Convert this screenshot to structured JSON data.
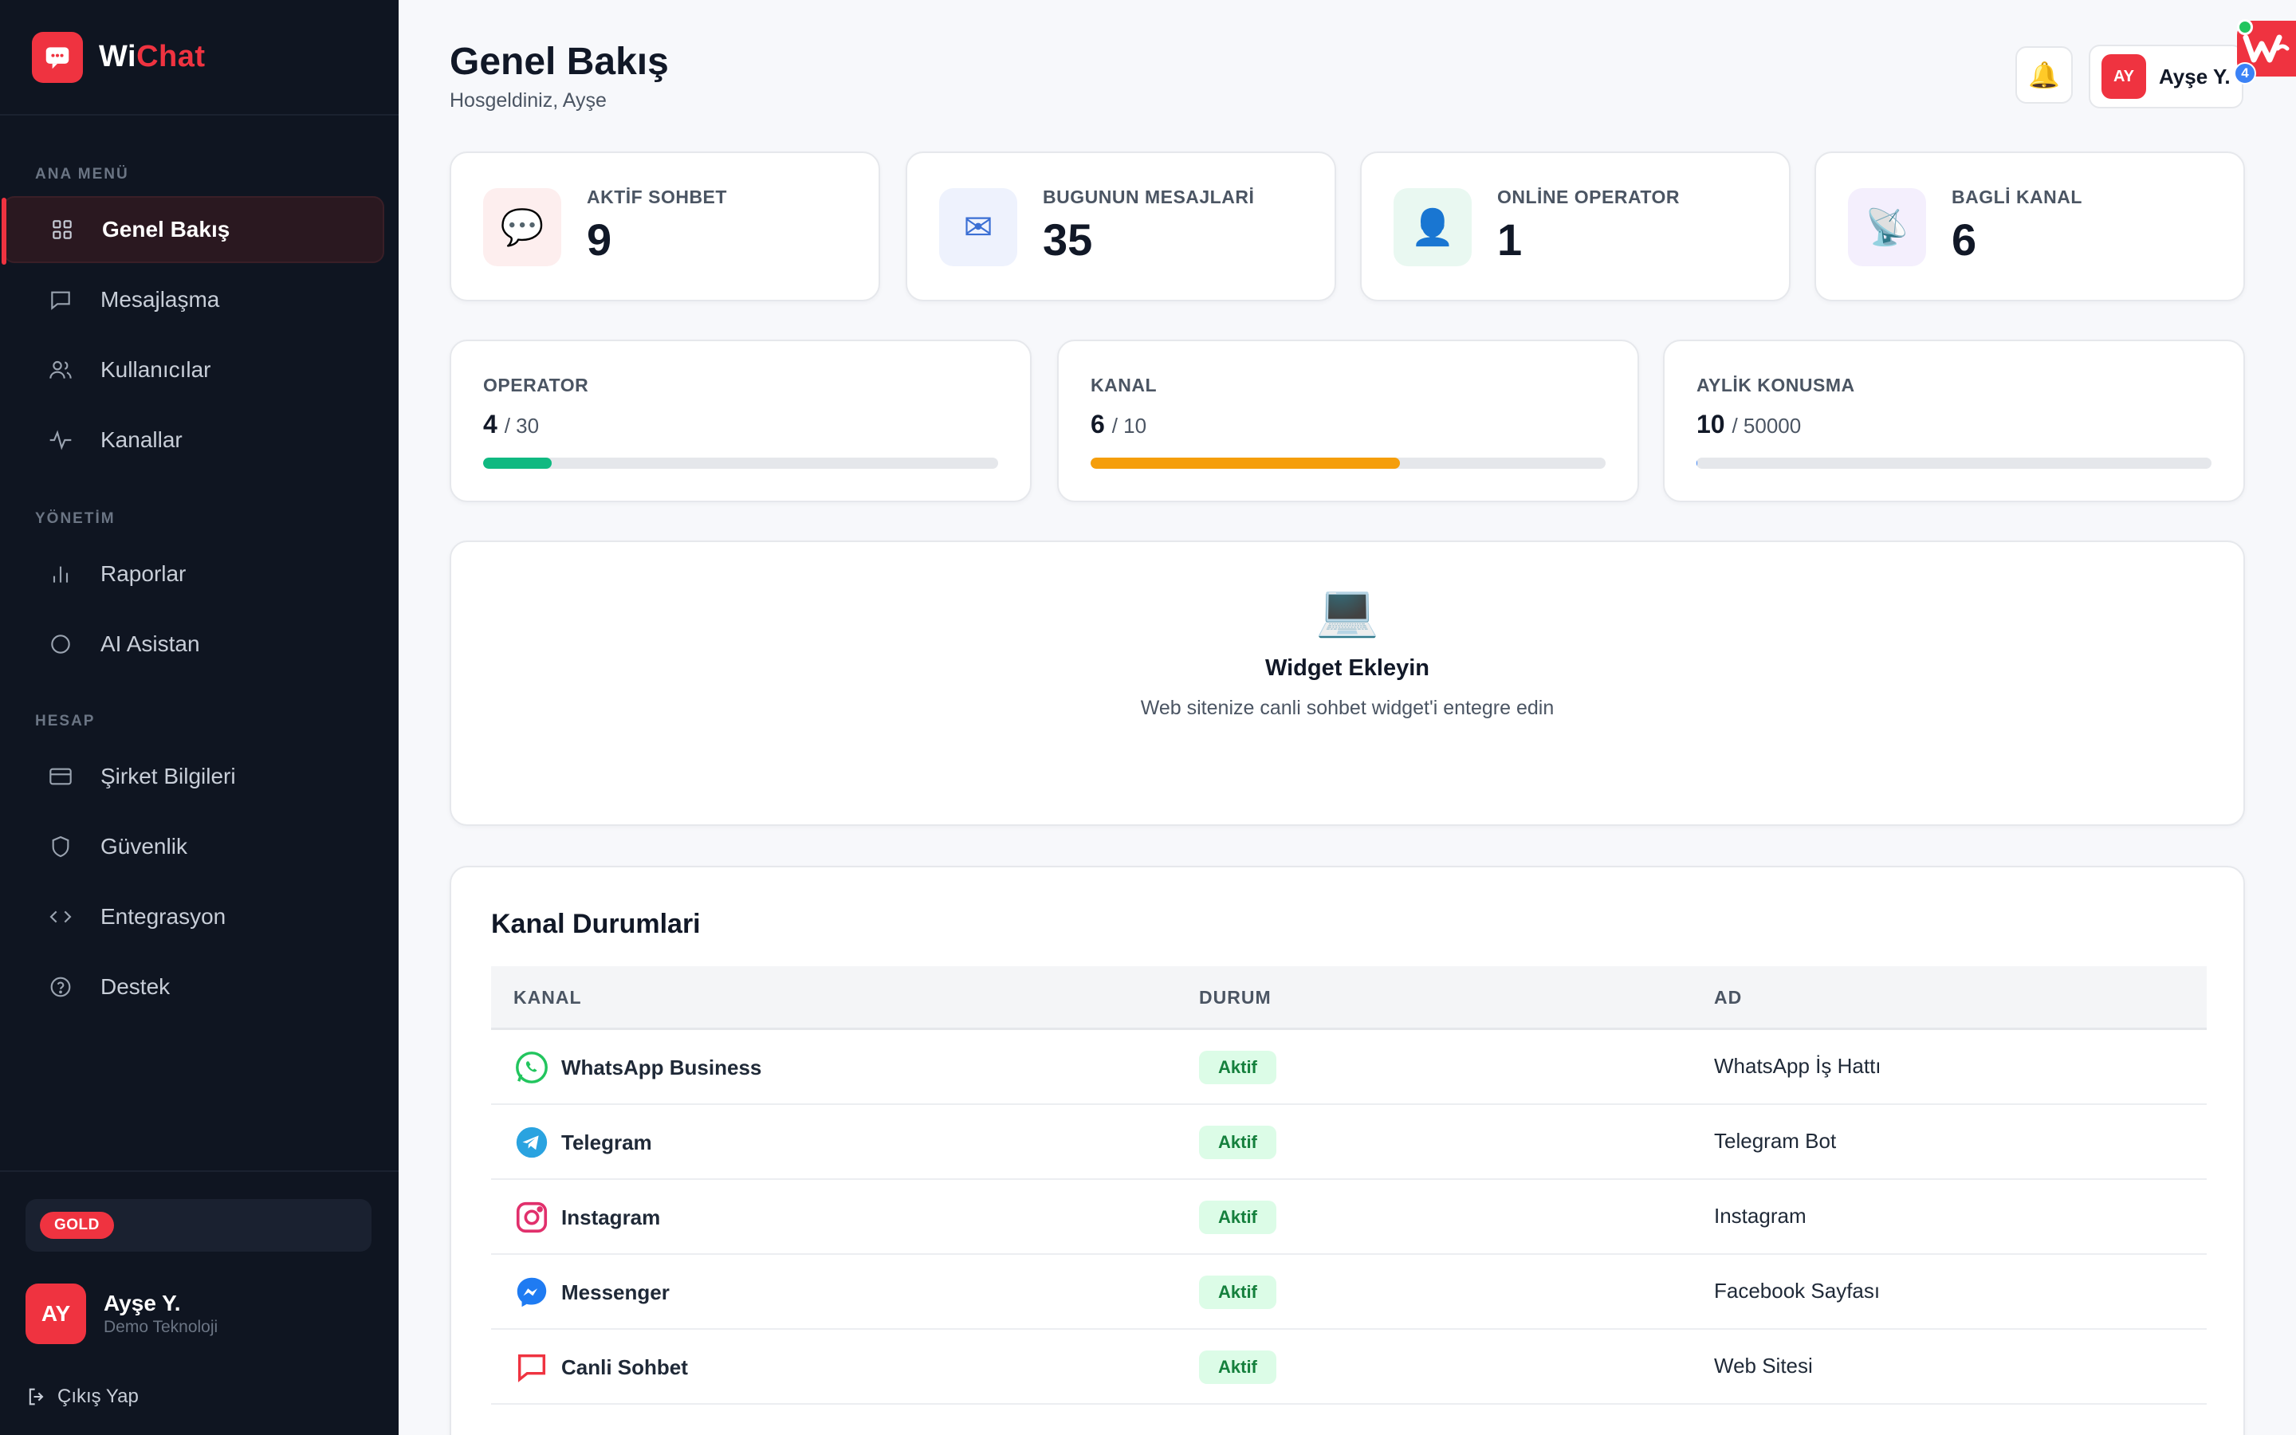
{
  "brand": {
    "name_part1": "Wi",
    "name_part2": "Chat"
  },
  "sidebar": {
    "sections": [
      {
        "label": "ANA MENÜ"
      },
      {
        "label": "YÖNETİM"
      },
      {
        "label": "HESAP"
      }
    ],
    "items": [
      {
        "label": "Genel Bakış",
        "icon": "grid-icon",
        "active": true
      },
      {
        "label": "Mesajlaşma",
        "icon": "message-icon"
      },
      {
        "label": "Kullanıcılar",
        "icon": "users-icon"
      },
      {
        "label": "Kanallar",
        "icon": "pulse-icon"
      },
      {
        "label": "Raporlar",
        "icon": "bar-chart-icon"
      },
      {
        "label": "AI Asistan",
        "icon": "circle-icon"
      },
      {
        "label": "Şirket Bilgileri",
        "icon": "card-icon"
      },
      {
        "label": "Güvenlik",
        "icon": "shield-icon"
      },
      {
        "label": "Entegrasyon",
        "icon": "code-icon"
      },
      {
        "label": "Destek",
        "icon": "help-icon"
      }
    ],
    "plan": "GOLD",
    "user": {
      "initials": "AY",
      "name": "Ayşe Y.",
      "company": "Demo Teknoloji"
    },
    "logout_label": "Çıkış Yap"
  },
  "header": {
    "title": "Genel Bakış",
    "subtitle": "Hosgeldiniz, Ayşe",
    "user_initials": "AY",
    "user_name": "Ayşe Y.",
    "notification_count": "4"
  },
  "stats": [
    {
      "label": "AKTİF SOHBET",
      "value": "9",
      "icon": "chat-bubble-icon",
      "color": "#fdeeee"
    },
    {
      "label": "BUGUNUN MESAJLARİ",
      "value": "35",
      "icon": "envelope-icon",
      "color": "#eef2fd"
    },
    {
      "label": "ONLİNE OPERATOR",
      "value": "1",
      "icon": "person-icon",
      "color": "#e9f8f1"
    },
    {
      "label": "BAGLİ KANAL",
      "value": "6",
      "icon": "satellite-icon",
      "color": "#f4effd"
    }
  ],
  "quotas": [
    {
      "label": "OPERATOR",
      "value": "4",
      "max": "/ 30",
      "fraction": 0.133,
      "color": "#10b981"
    },
    {
      "label": "KANAL",
      "value": "6",
      "max": "/ 10",
      "fraction": 0.6,
      "color": "#f59e0b"
    },
    {
      "label": "AYLİK KONUSMA",
      "value": "10",
      "max": "/ 50000",
      "fraction": 0.0002,
      "color": "#3b82f6"
    }
  ],
  "widget": {
    "icon": "laptop-icon",
    "title": "Widget Ekleyin",
    "description": "Web sitenize canli sohbet widget'i entegre edin"
  },
  "channels": {
    "title": "Kanal Durumlari",
    "columns": [
      "KANAL",
      "DURUM",
      "AD"
    ],
    "rows": [
      {
        "channel": "WhatsApp Business",
        "icon": "whatsapp-icon",
        "status": "Aktif",
        "name": "WhatsApp İş Hattı"
      },
      {
        "channel": "Telegram",
        "icon": "telegram-icon",
        "status": "Aktif",
        "name": "Telegram Bot"
      },
      {
        "channel": "Instagram",
        "icon": "instagram-icon",
        "status": "Aktif",
        "name": "Instagram"
      },
      {
        "channel": "Messenger",
        "icon": "messenger-icon",
        "status": "Aktif",
        "name": "Facebook Sayfası"
      },
      {
        "channel": "Canli Sohbet",
        "icon": "live-chat-icon",
        "status": "Aktif",
        "name": "Web Sitesi"
      }
    ]
  },
  "colors": {
    "accent": "#ef3340",
    "sidebar_bg": "#0f1521",
    "success": "#15803d"
  }
}
